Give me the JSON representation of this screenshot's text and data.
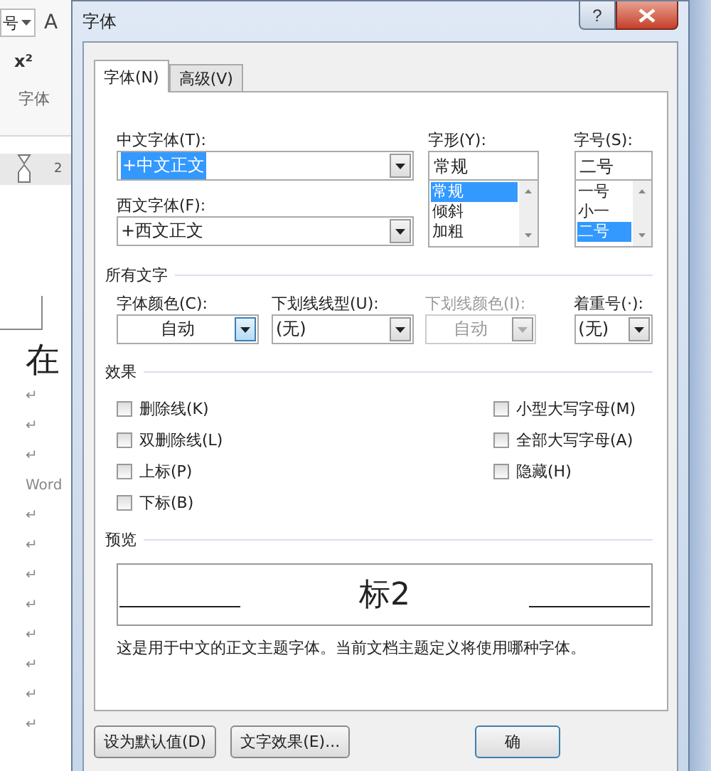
{
  "word": {
    "size_box": "号",
    "grow_font": "A",
    "superscript": "x²",
    "group_label": "字体",
    "ruler_number": "2",
    "heading_char": "在",
    "lines": [
      "↵",
      "↵",
      "↵",
      "Word",
      "↵",
      "↵",
      "↵",
      "↵",
      "↵",
      "↵",
      "↵",
      "↵"
    ]
  },
  "dialog": {
    "title": "字体",
    "help": "?",
    "tabs": [
      {
        "label": "字体(N)",
        "selected": true
      },
      {
        "label": "高级(V)",
        "selected": false
      }
    ],
    "chinese_font": {
      "label": "中文字体(T):",
      "value": "+中文正文",
      "highlighted": true
    },
    "western_font": {
      "label": "西文字体(F):",
      "value": "+西文正文",
      "highlighted": false
    },
    "style": {
      "label": "字形(Y):",
      "value": "常规",
      "options": [
        {
          "text": "常规",
          "selected": true
        },
        {
          "text": "倾斜",
          "selected": false
        },
        {
          "text": "加粗",
          "selected": false
        }
      ]
    },
    "size": {
      "label": "字号(S):",
      "value": "二号",
      "options": [
        {
          "text": "一号",
          "selected": false
        },
        {
          "text": "小一",
          "selected": false
        },
        {
          "text": "二号",
          "selected": true
        }
      ]
    },
    "all_text": {
      "heading": "所有文字",
      "fields": [
        {
          "label": "字体颜色(C):",
          "value": "自动",
          "disabled": false,
          "kind": "center"
        },
        {
          "label": "下划线线型(U):",
          "value": "(无)",
          "disabled": false,
          "kind": "left"
        },
        {
          "label": "下划线颜色(I):",
          "value": "自动",
          "disabled": true,
          "kind": "center"
        },
        {
          "label": "着重号(·):",
          "value": "(无)",
          "disabled": false,
          "kind": "left"
        }
      ]
    },
    "effects": {
      "heading": "效果",
      "left": [
        {
          "label": "删除线(K)",
          "checked": false
        },
        {
          "label": "双删除线(L)",
          "checked": false
        },
        {
          "label": "上标(P)",
          "checked": false
        },
        {
          "label": "下标(B)",
          "checked": false
        }
      ],
      "right": [
        {
          "label": "小型大写字母(M)",
          "checked": false
        },
        {
          "label": "全部大写字母(A)",
          "checked": false
        },
        {
          "label": "隐藏(H)",
          "checked": false
        }
      ]
    },
    "preview": {
      "heading": "预览",
      "sample": "标2",
      "note": "这是用于中文的正文主题字体。当前文档主题定义将使用哪种字体。"
    },
    "buttons": [
      "设为默认值(D)",
      "文字效果(E)...",
      "确"
    ]
  }
}
